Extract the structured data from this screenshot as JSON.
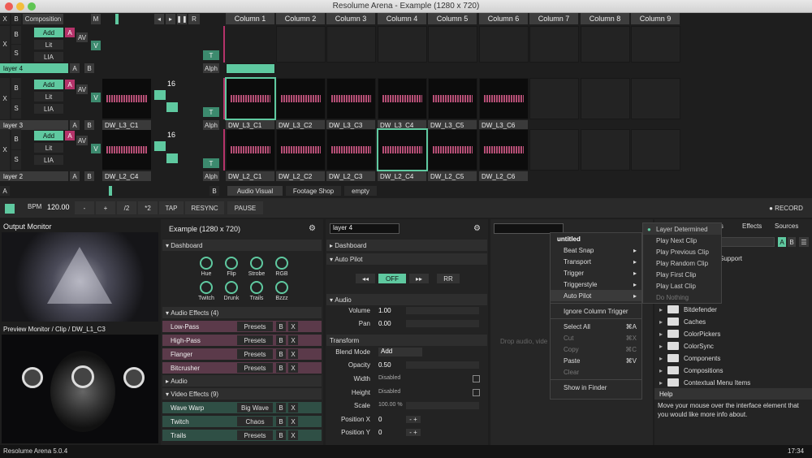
{
  "window": {
    "title": "Resolume Arena - Example (1280 x 720)"
  },
  "deck": {
    "composition_label": "Composition",
    "master_label": "M",
    "x": "X",
    "b": "B",
    "s": "S",
    "a": "A",
    "av": "AV",
    "v": "V",
    "t": "T",
    "alph": "Alph",
    "add": "Add",
    "lit": "Lit",
    "lia": "LIA",
    "speed": "16"
  },
  "columns": [
    "Column 1",
    "Column 2",
    "Column 3",
    "Column 4",
    "Column 5",
    "Column 6",
    "Column 7",
    "Column 8",
    "Column 9"
  ],
  "layers": [
    {
      "name": "layer 4",
      "clips": []
    },
    {
      "name": "layer 3",
      "first_clip": "DW_L3_C1",
      "clips": [
        "DW_L3_C1",
        "DW_L3_C2",
        "DW_L3_C3",
        "DW_L3_C4",
        "DW_L3_C5",
        "DW_L3_C6"
      ]
    },
    {
      "name": "layer 2",
      "first_clip": "DW_L2_C4",
      "clips": [
        "DW_L2_C1",
        "DW_L2_C2",
        "DW_L2_C3",
        "DW_L2_C4",
        "DW_L2_C5",
        "DW_L2_C6"
      ]
    }
  ],
  "deck_tabs": {
    "a": "A",
    "b": "B",
    "tabs": [
      "Audio Visual",
      "Footage Shop",
      "empty"
    ]
  },
  "transport": {
    "bpm_label": "BPM",
    "bpm": "120.00",
    "minus": "-",
    "plus": "+",
    "div": "/2",
    "mul": "*2",
    "tap": "TAP",
    "resync": "RESYNC",
    "pause": "PAUSE",
    "record": "● RECORD"
  },
  "output": {
    "title": "Output Monitor",
    "preview": "Preview Monitor / Clip / DW_L1_C3"
  },
  "comp_panel": {
    "title": "Example (1280 x 720)",
    "dashboard": "Dashboard",
    "knobs": [
      "Hue",
      "Flip",
      "Strobe",
      "RGB",
      "Twitch",
      "Drunk",
      "Trails",
      "Bzzz"
    ],
    "audio_fx": "Audio Effects (4)",
    "audio_items": [
      {
        "name": "Low-Pass",
        "preset": "Presets"
      },
      {
        "name": "High-Pass",
        "preset": "Presets"
      },
      {
        "name": "Flanger",
        "preset": "Presets"
      },
      {
        "name": "Bitcrusher",
        "preset": "Presets"
      }
    ],
    "audio": "Audio",
    "video_fx": "Video Effects (9)",
    "video_items": [
      {
        "name": "Wave Warp",
        "preset": "Big Wave"
      },
      {
        "name": "Twitch",
        "preset": "Chaos"
      },
      {
        "name": "Trails",
        "preset": "Presets"
      }
    ],
    "b": "B",
    "x": "X"
  },
  "layer_panel": {
    "name": "layer 4",
    "dashboard": "Dashboard",
    "autopilot": "Auto Pilot",
    "off": "OFF",
    "rr": "RR",
    "audio": "Audio",
    "volume_label": "Volume",
    "volume": "1.00",
    "pan_label": "Pan",
    "pan": "0.00",
    "transform": "Transform",
    "blend_label": "Blend Mode",
    "blend": "Add",
    "opacity_label": "Opacity",
    "opacity": "0.50",
    "width_label": "Width",
    "width": "Disabled",
    "height_label": "Height",
    "height": "Disabled",
    "scale_label": "Scale",
    "scale": "100.00 %",
    "posx_label": "Position X",
    "posx": "0",
    "posy_label": "Position Y",
    "posy": "0"
  },
  "context_menu": {
    "title": "untitled",
    "items": [
      "Beat Snap",
      "Transport",
      "Trigger",
      "Triggerstyle",
      "Auto Pilot"
    ],
    "ignore": "Ignore Column Trigger",
    "select_all": "Select All",
    "select_all_key": "⌘A",
    "cut": "Cut",
    "cut_key": "⌘X",
    "copy": "Copy",
    "copy_key": "⌘C",
    "paste": "Paste",
    "paste_key": "⌘V",
    "clear": "Clear",
    "finder": "Show in Finder"
  },
  "autopilot_sub": [
    "Layer Determined",
    "Play Next Clip",
    "Play Previous Clip",
    "Play Random Clip",
    "Play First Clip",
    "Play Last Clip",
    "Do Nothing"
  ],
  "drop_hint": "Drop audio, vide",
  "browser": {
    "tabs": [
      "ons",
      "Effects",
      "Sources"
    ],
    "a": "A",
    "b": "B",
    "support": "Support",
    "folders": [
      "Bitdefender",
      "Caches",
      "ColorPickers",
      "ColorSync",
      "Components",
      "Compositions",
      "Contextual Menu Items"
    ],
    "help_title": "Help",
    "help_text": "Move your mouse over the interface element that you would like more info about."
  },
  "status": {
    "app": "Resolume Arena 5.0.4",
    "time": "17:34"
  },
  "colors": {
    "accent": "#5fc9a0",
    "pink": "#b5336a"
  }
}
